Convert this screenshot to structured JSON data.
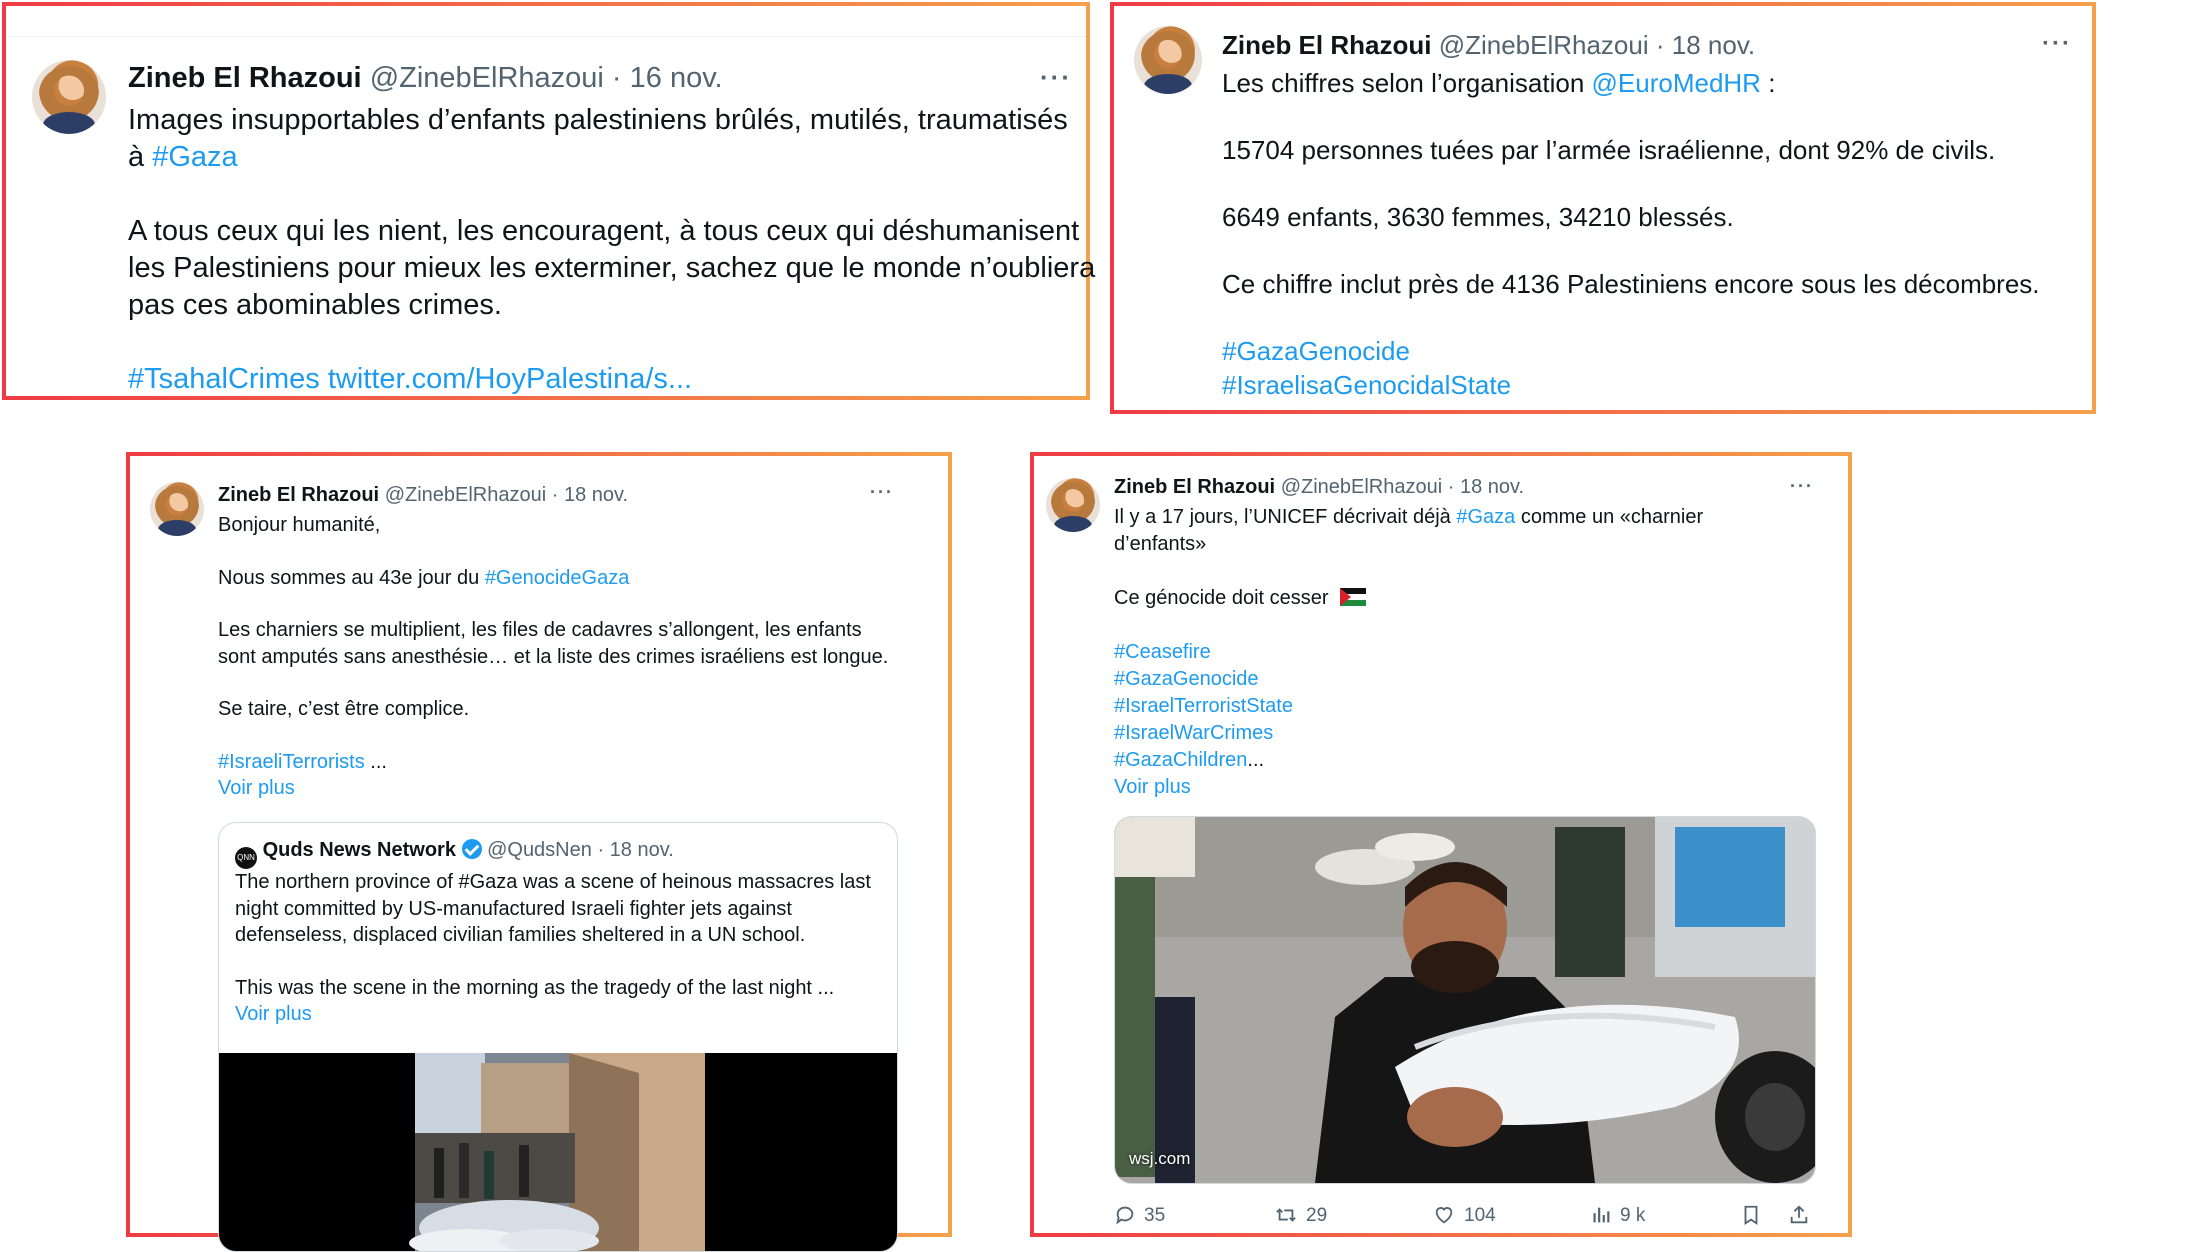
{
  "tweet1": {
    "name": "Zineb El Rhazoui",
    "handle": "@ZinebElRhazoui",
    "date": "· 16 nov.",
    "more": "···",
    "line1": "Images insupportables d’enfants palestiniens brûlés, mutilés, traumatisés",
    "line2_prefix": "à ",
    "line2_tag": "#Gaza",
    "line3": "A tous ceux qui les nient, les encouragent, à tous ceux qui déshumanisent",
    "line4": "les Palestiniens pour mieux les exterminer, sachez que le monde n’oubliera",
    "line5": "pas ces abominables crimes.",
    "tag_link": "#TsahalCrimes twitter.com/HoyPalestina/s..."
  },
  "tweet2": {
    "name": "Zineb El Rhazoui",
    "handle": "@ZinebElRhazoui",
    "date": "· 18 nov.",
    "more": "···",
    "line1_prefix": "Les chiffres selon l’organisation ",
    "line1_mention": "@EuroMedHR",
    "line1_suffix": " :",
    "line2": "15704 personnes tuées par l’armée israélienne, dont 92% de civils.",
    "line3": "6649 enfants, 3630 femmes, 34210 blessés.",
    "line4": "Ce chiffre inclut près de 4136 Palestiniens encore sous les décombres.",
    "tag1": "#GazaGenocide",
    "tag2": "#IsraelisaGenocidalState"
  },
  "tweet3": {
    "name": "Zineb El Rhazoui",
    "handle": "@ZinebElRhazoui",
    "date": "· 18 nov.",
    "more": "···",
    "line1": "Bonjour humanité,",
    "line2_prefix": "Nous sommes au 43e jour du ",
    "line2_tag": "#GenocideGaza",
    "line3": "Les charniers se multiplient, les files de cadavres s’allongent, les enfants",
    "line4": "sont amputés sans anesthésie… et la liste des crimes israéliens est longue.",
    "line5": "Se taire, c’est être complice.",
    "tag": "#IsraeliTerrorists",
    "tag_suffix": " ...",
    "see_more": "Voir plus",
    "quote": {
      "logo": "QNN",
      "name": "Quds News Network",
      "handle": "@QudsNen",
      "date": "· 18 nov.",
      "line1": "The northern province of #Gaza was a scene of heinous massacres last",
      "line2": "night committed by US-manufactured Israeli fighter jets against",
      "line3": "defenseless, displaced civilian families sheltered in a UN school.",
      "line4": "This was the scene in the morning as the tragedy of the last night ...",
      "see_more": "Voir plus"
    }
  },
  "tweet4": {
    "name": "Zineb El Rhazoui",
    "handle": "@ZinebElRhazoui",
    "date": "· 18 nov.",
    "more": "···",
    "line1_prefix": "Il y a 17 jours, l’UNICEF décrivait déjà ",
    "line1_tag": "#Gaza",
    "line1_suffix": " comme un «charnier",
    "line2": "d’enfants»",
    "line3": "Ce génocide doit cesser",
    "tags": [
      "#Ceasefire",
      "#GazaGenocide",
      "#IsraelTerroristState",
      "#IsraelWarCrimes"
    ],
    "tag_last": "#GazaChildren",
    "tag_last_suffix": "...",
    "see_more": "Voir plus",
    "image_source": "wsj.com",
    "metrics": {
      "replies": "35",
      "retweets": "29",
      "likes": "104",
      "views": "9 k"
    }
  },
  "colors": {
    "link": "#1d9bf0",
    "text": "#0f1419",
    "muted": "#536471",
    "frame_start": "#ef3b45",
    "frame_end": "#f5a04a"
  }
}
